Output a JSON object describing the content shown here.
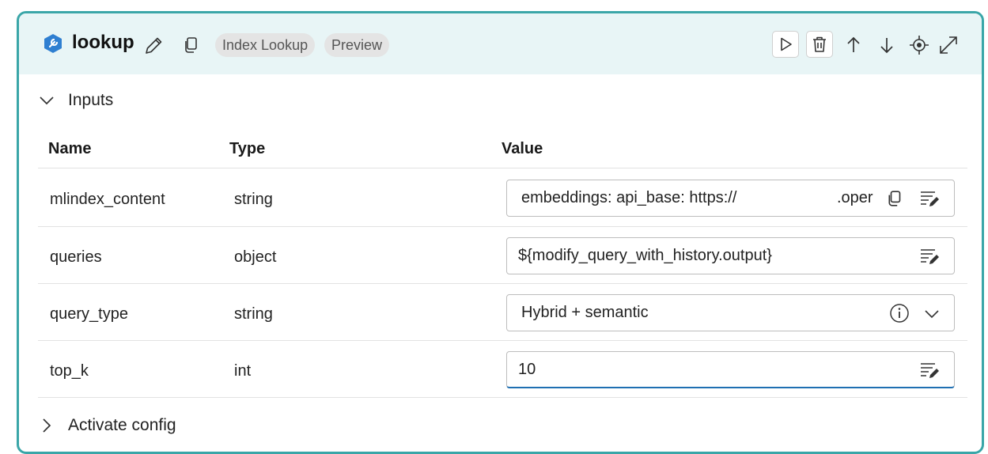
{
  "header": {
    "title": "lookup",
    "tags": [
      "Index Lookup",
      "Preview"
    ]
  },
  "inputs_section": {
    "label": "Inputs"
  },
  "table": {
    "columns": [
      "Name",
      "Type",
      "Value"
    ],
    "rows": [
      {
        "name": "mlindex_content",
        "type": "string",
        "value_start": "embeddings:  api_base: https://",
        "value_end": ".oper"
      },
      {
        "name": "queries",
        "type": "object",
        "value": "${modify_query_with_history.output}"
      },
      {
        "name": "query_type",
        "type": "string",
        "value": "Hybrid + semantic"
      },
      {
        "name": "top_k",
        "type": "int",
        "value": "10"
      }
    ]
  },
  "activate_section": {
    "label": "Activate config"
  },
  "colors": {
    "accent": "#3aa6a8",
    "header_bg": "#e8f5f6",
    "focus": "#1f6fb2",
    "icon_blue": "#2f7fd1"
  },
  "icons": [
    "wrench-icon",
    "pencil-icon",
    "copy-icon",
    "play-icon",
    "trash-icon",
    "arrow-up-icon",
    "arrow-down-icon",
    "locate-icon",
    "expand-icon",
    "chevron-down-icon",
    "chevron-right-icon",
    "info-icon",
    "edit-text-icon"
  ]
}
